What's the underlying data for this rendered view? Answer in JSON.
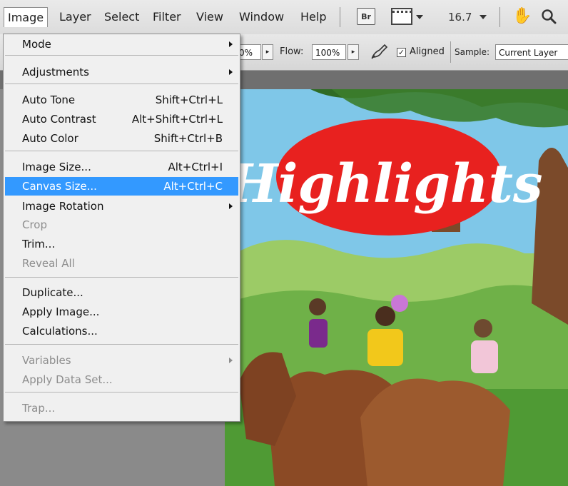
{
  "menubar": {
    "items": [
      "Image",
      "Layer",
      "Select",
      "Filter",
      "View",
      "Window",
      "Help"
    ],
    "bridge_label": "Br",
    "zoom": "16.7"
  },
  "options": {
    "opacity_partial": "0%",
    "flow_label": "Flow:",
    "flow_value": "100%",
    "aligned_label": "Aligned",
    "aligned_checked": true,
    "sample_label": "Sample:",
    "sample_value": "Current Layer"
  },
  "image_menu": {
    "items": [
      {
        "label": "Mode",
        "shortcut": "",
        "submenu": true,
        "disabled": false
      },
      {
        "label": "Adjustments",
        "shortcut": "",
        "submenu": true,
        "disabled": false
      },
      {
        "label": "Auto Tone",
        "shortcut": "Shift+Ctrl+L",
        "submenu": false,
        "disabled": false
      },
      {
        "label": "Auto Contrast",
        "shortcut": "Alt+Shift+Ctrl+L",
        "submenu": false,
        "disabled": false
      },
      {
        "label": "Auto Color",
        "shortcut": "Shift+Ctrl+B",
        "submenu": false,
        "disabled": false
      },
      {
        "label": "Image Size...",
        "shortcut": "Alt+Ctrl+I",
        "submenu": false,
        "disabled": false
      },
      {
        "label": "Canvas Size...",
        "shortcut": "Alt+Ctrl+C",
        "submenu": false,
        "disabled": false,
        "highlighted": true
      },
      {
        "label": "Image Rotation",
        "shortcut": "",
        "submenu": true,
        "disabled": false
      },
      {
        "label": "Crop",
        "shortcut": "",
        "submenu": false,
        "disabled": true
      },
      {
        "label": "Trim...",
        "shortcut": "",
        "submenu": false,
        "disabled": false
      },
      {
        "label": "Reveal All",
        "shortcut": "",
        "submenu": false,
        "disabled": true
      },
      {
        "label": "Duplicate...",
        "shortcut": "",
        "submenu": false,
        "disabled": false
      },
      {
        "label": "Apply Image...",
        "shortcut": "",
        "submenu": false,
        "disabled": false
      },
      {
        "label": "Calculations...",
        "shortcut": "",
        "submenu": false,
        "disabled": false
      },
      {
        "label": "Variables",
        "shortcut": "",
        "submenu": true,
        "disabled": true
      },
      {
        "label": "Apply Data Set...",
        "shortcut": "",
        "submenu": false,
        "disabled": true
      },
      {
        "label": "Trap...",
        "shortcut": "",
        "submenu": false,
        "disabled": true
      }
    ]
  },
  "artwork": {
    "title": "Highlights",
    "colors": {
      "sky": "#7fc7e8",
      "grass": "#58a83a",
      "oval": "#e8211f",
      "tree": "#7b4a2a",
      "highlight": "#3399ff"
    }
  }
}
